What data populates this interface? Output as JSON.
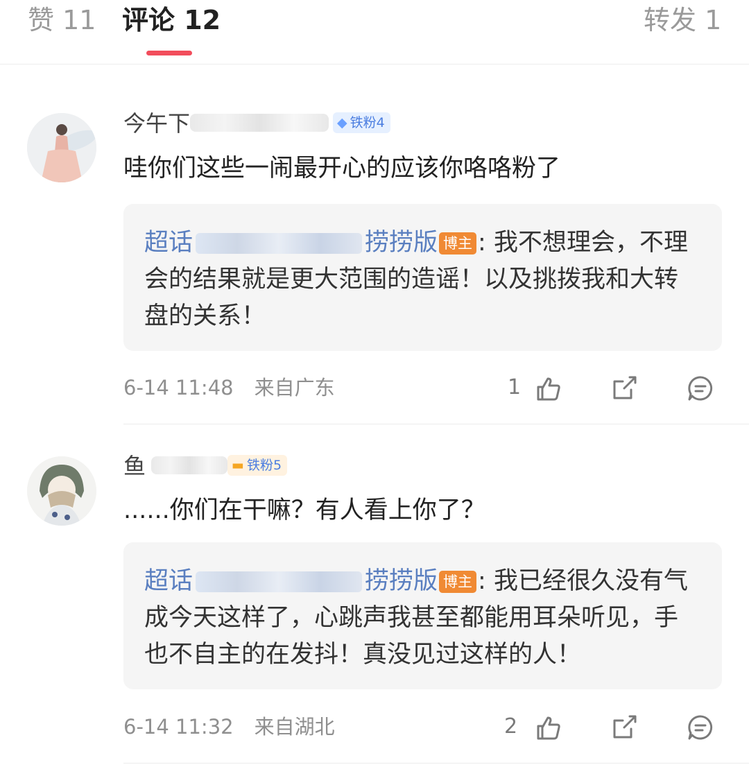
{
  "tabs": {
    "likes": "赞 11",
    "comments": "评论 12",
    "reposts": "转发 1"
  },
  "comments": [
    {
      "username_prefix": "今午下",
      "badge": "铁粉4",
      "text": "哇你们这些一闹最开心的应该你咯咯粉了",
      "reply": {
        "author_prefix": "超话",
        "author_suffix": "捞捞版",
        "host_tag": "博主",
        "text": ": 我不想理会，不理会的结果就是更大范围的造谣！以及挑拨我和大转盘的关系！"
      },
      "date": "6-14 11:48",
      "location": "来自广东",
      "likes": "1"
    },
    {
      "username_prefix": "鱼",
      "badge": "铁粉5",
      "text": "......你们在干嘛？有人看上你了？",
      "reply": {
        "author_prefix": "超话",
        "author_suffix": "捞捞版",
        "host_tag": "博主",
        "text": ": 我已经很久没有气成今天这样了，心跳声我甚至都能用耳朵听见，手也不自主的在发抖！真没见过这样的人！"
      },
      "date": "6-14 11:32",
      "location": "来自湖北",
      "likes": "2"
    }
  ],
  "colors": {
    "accent": "#f24d5c",
    "reply_author": "#5a7fc0",
    "host_tag": "#f08a34",
    "badge_bg": "#e6f0ff"
  },
  "icons": [
    "like-icon",
    "repost-icon",
    "comment-icon"
  ]
}
